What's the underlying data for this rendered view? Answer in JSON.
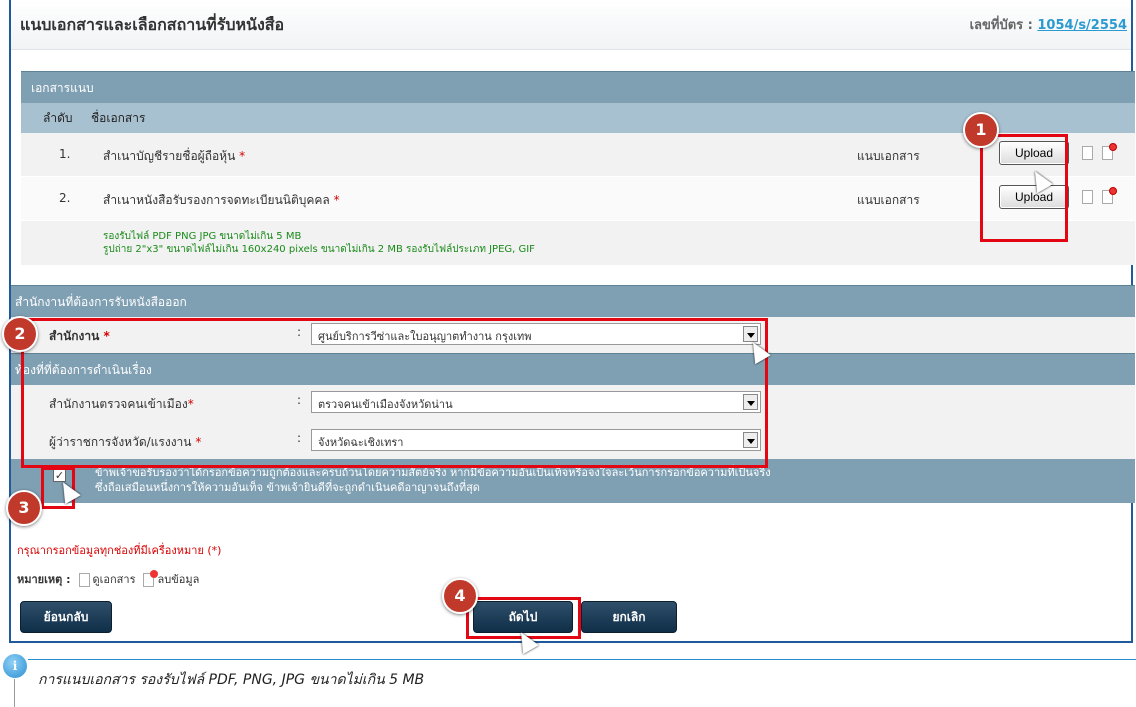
{
  "header": {
    "title": "แนบเอกสารและเลือกสถานที่รับหนังสือ",
    "card_label": "เลขที่บัตร :",
    "card_number": "1054/s/2554"
  },
  "attachments": {
    "section_title": "เอกสารแนบ",
    "col_order": "ลำดับ",
    "col_name": "ชื่อเอกสาร",
    "rows": [
      {
        "no": "1.",
        "name": "สำเนาบัญชีรายชื่อผู้ถือหุ้น",
        "required": "*",
        "action": "แนบเอกสาร",
        "upload": "Upload"
      },
      {
        "no": "2.",
        "name": "สำเนาหนังสือรับรองการจดทะเบียนนิติบุคคล",
        "required": "*",
        "action": "แนบเอกสาร",
        "upload": "Upload"
      }
    ],
    "note1": "รองรับไฟล์ PDF PNG JPG ขนาดไม่เกิน 5 MB",
    "note2": "รูปถ่าย 2\"x3\" ขนาดไฟล์ไม่เกิน 160x240 pixels ขนาดไม่เกิน 2 MB รองรับไฟล์ประเภท JPEG, GIF"
  },
  "pickup": {
    "section_title": "สำนักงานที่ต้องการรับหนังสือออก",
    "office_label": "สำนักงาน",
    "required": "*",
    "colon": ":",
    "office_value": "ศูนย์บริการวีซ่าและใบอนุญาตทำงาน กรุงเทพ"
  },
  "area": {
    "section_title": "ท้องที่ที่ต้องการดำเนินเรื่อง",
    "imm_label": "สำนักงานตรวจคนเข้าเมือง",
    "imm_value": "ตรวจคนเข้าเมืองจังหวัดน่าน",
    "gov_label": "ผู้ว่าราชการจังหวัด/แรงงาน",
    "gov_value": "จังหวัดฉะเชิงเทรา",
    "required": "*",
    "colon": ":"
  },
  "agree": {
    "checked": "✓",
    "line1": "ข้าพเจ้าขอรับรองว่าได้กรอกข้อความถูกต้องและครบถ้วนโดยความสัตย์จริง หากมีข้อความอันเป็นเท็จหรือจงใจละเว้นการกรอกข้อความที่เป็นจริง",
    "line2": "ซึ่งถือเสมือนหนึ่งการให้ความอันเท็จ ข้าพเจ้ายินดีที่จะถูกดำเนินคดีอาญาจนถึงที่สุด"
  },
  "required_note": "กรุณากรอกข้อมูลทุกช่องที่มีเครื่องหมาย (*)",
  "legend": {
    "label": "หมายเหตุ :",
    "view": "ดูเอกสาร",
    "delete": "ลบข้อมูล"
  },
  "buttons": {
    "back": "ย้อนกลับ",
    "next": "ถัดไป",
    "cancel": "ยกเลิก"
  },
  "steps": [
    "1",
    "2",
    "3",
    "4"
  ],
  "info": {
    "icon": "i",
    "text": "การแนบเอกสาร รองรับไฟล์ PDF, PNG, JPG ขนาดไม่เกิน 5 MB"
  }
}
